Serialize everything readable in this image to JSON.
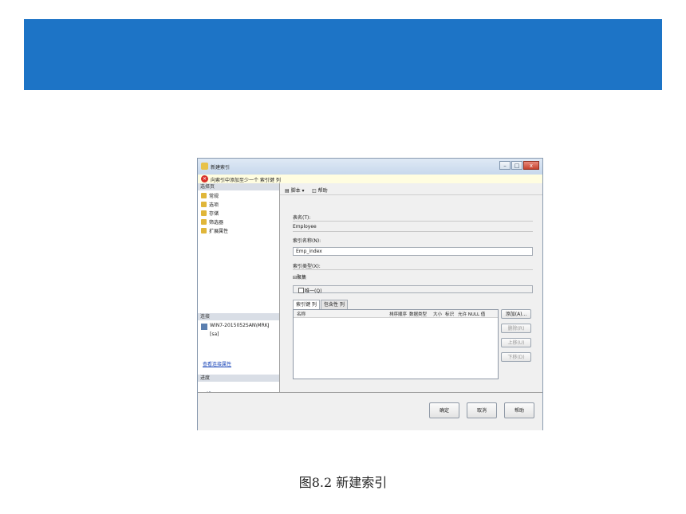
{
  "colors": {
    "banner": "#1d74c6"
  },
  "window": {
    "title": "新建索引",
    "controls": [
      "–",
      "□",
      "x"
    ],
    "error_message": "向索引中添加至少一个 索引键 列"
  },
  "left_panel": {
    "select_page_header": "选择页",
    "pages": [
      "常规",
      "选项",
      "存储",
      "筛选器",
      "扩展属性"
    ],
    "connection_header": "连接",
    "server": "WIN7-2015052SAN\\MRKJ",
    "user": "[sa]",
    "view_connection_link": "查看连接属性",
    "progress_header": "进度",
    "status": "就绪"
  },
  "toolbar": {
    "script_label": "脚本",
    "help_label": "帮助"
  },
  "form": {
    "table_name_label": "表名(T):",
    "table_name_value": "Employee",
    "index_name_label": "索引名称(N):",
    "index_name_value": "Emp_index",
    "index_type_label": "索引类型(X):",
    "clustered_label": "⊟聚集",
    "unique_label": "唯一(Q)"
  },
  "tabs": [
    "索引键 列",
    "包含性 列"
  ],
  "grid": {
    "columns": [
      "名称",
      "排序顺序",
      "数据类型",
      "大小",
      "标识",
      "允许 NULL 值"
    ]
  },
  "side_buttons": {
    "add": "添加(A)...",
    "remove": "删除(R)",
    "up": "上移(U)",
    "down": "下移(D)"
  },
  "footer": {
    "ok": "确定",
    "cancel": "取消",
    "help": "帮助"
  },
  "caption": "图8.2 新建索引"
}
